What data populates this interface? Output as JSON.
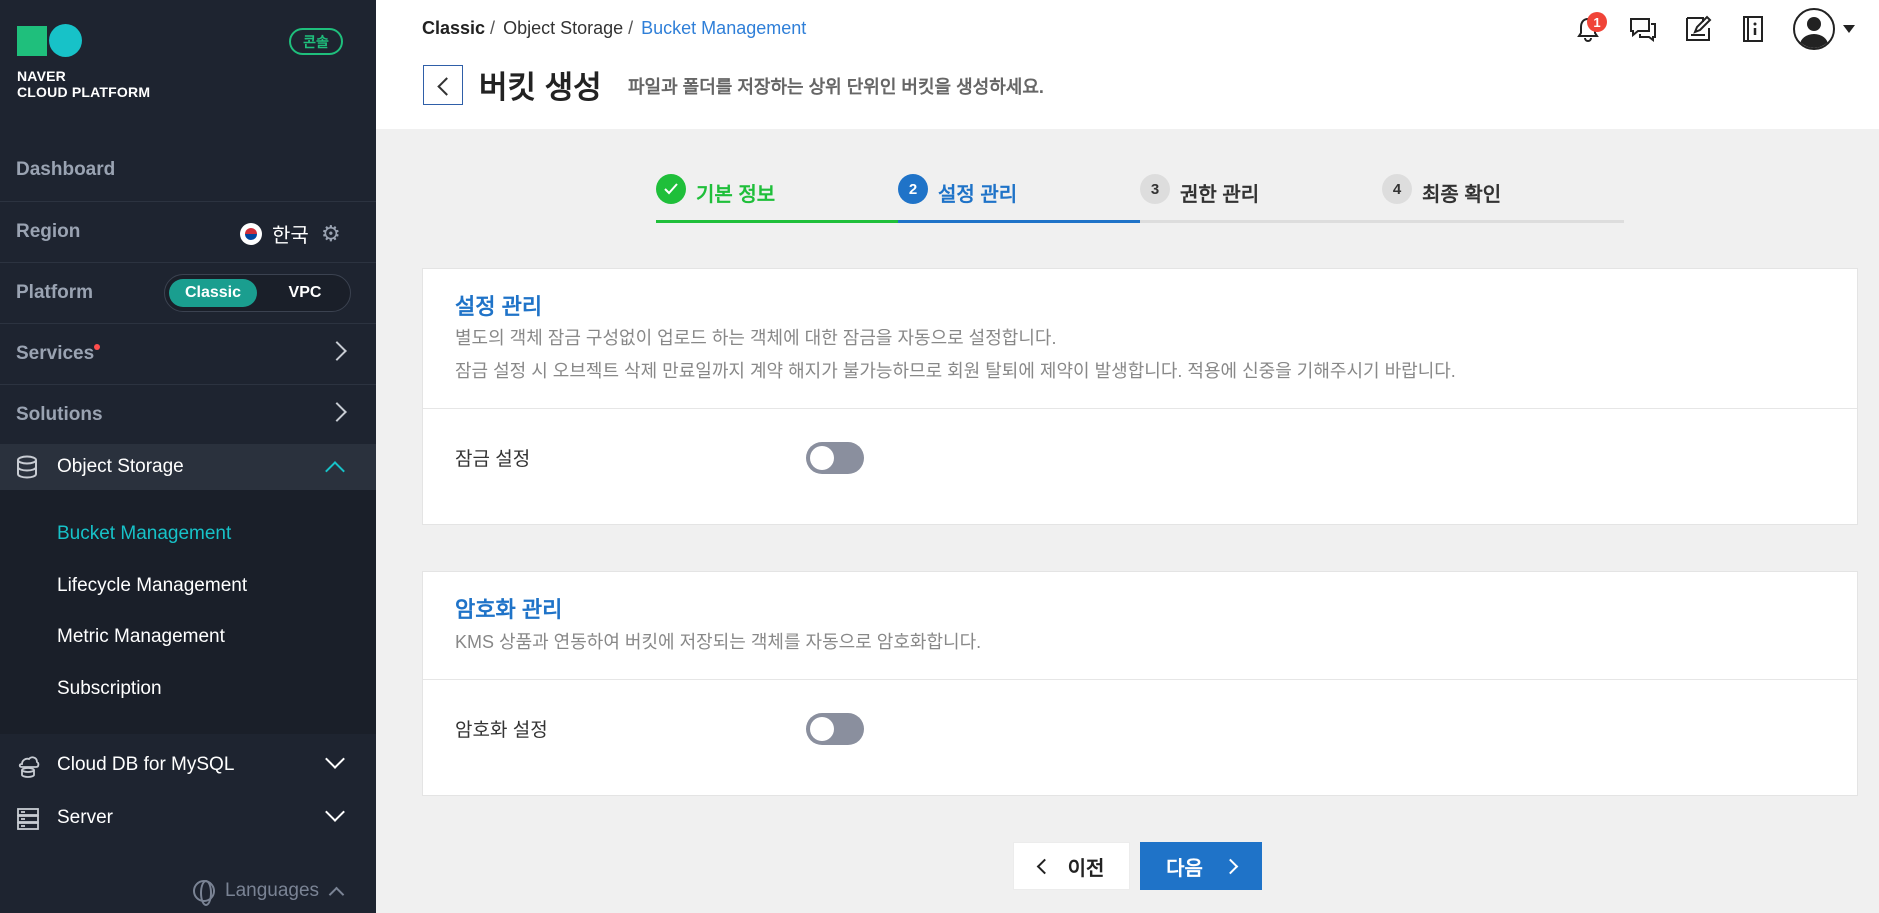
{
  "sidebar": {
    "logo_line1": "NAVER",
    "logo_line2": "CLOUD PLATFORM",
    "console_badge": "콘솔",
    "dashboard": "Dashboard",
    "region_label": "Region",
    "region_value": "한국",
    "platform_label": "Platform",
    "platform_options": [
      "Classic",
      "VPC"
    ],
    "platform_selected": "Classic",
    "services": "Services",
    "solutions": "Solutions",
    "object_storage": "Object Storage",
    "object_storage_items": [
      "Bucket Management",
      "Lifecycle Management",
      "Metric Management",
      "Subscription"
    ],
    "active_item": "Bucket Management",
    "cloud_db": "Cloud DB for MySQL",
    "server": "Server",
    "languages": "Languages",
    "accent_color": "#17c2c8"
  },
  "header": {
    "breadcrumb": [
      "Classic",
      "Object Storage",
      "Bucket Management"
    ],
    "breadcrumb_sep": "/",
    "title": "버킷 생성",
    "description": "파일과 폴더를 저장하는 상위 단위인 버킷을 생성하세요.",
    "notification_count": "1",
    "icons": [
      "bell-icon",
      "chat-icon",
      "memo-icon",
      "info-book-icon",
      "user-avatar-icon"
    ]
  },
  "stepper": {
    "steps": [
      {
        "num": "1",
        "label": "기본 정보",
        "state": "done"
      },
      {
        "num": "2",
        "label": "설정 관리",
        "state": "current"
      },
      {
        "num": "3",
        "label": "권한 관리",
        "state": "todo"
      },
      {
        "num": "4",
        "label": "최종 확인",
        "state": "todo"
      }
    ],
    "done_color": "#1fbf3a",
    "current_color": "#1f73c8"
  },
  "lock_panel": {
    "title": "설정 관리",
    "desc1": "별도의 객체 잠금 구성없이 업로드 하는 객체에 대한 잠금을 자동으로 설정합니다.",
    "desc2": "잠금 설정 시 오브젝트 삭제 만료일까지 계약 해지가 불가능하므로 회원 탈퇴에 제약이 발생합니다. 적용에 신중을 기해주시기 바랍니다.",
    "field_label": "잠금 설정",
    "toggle_on": false
  },
  "encrypt_panel": {
    "title": "암호화 관리",
    "desc1": "KMS 상품과 연동하여 버킷에 저장되는 객체를 자동으로 암호화합니다.",
    "field_label": "암호화 설정",
    "toggle_on": false
  },
  "buttons": {
    "prev": "이전",
    "next": "다음"
  }
}
